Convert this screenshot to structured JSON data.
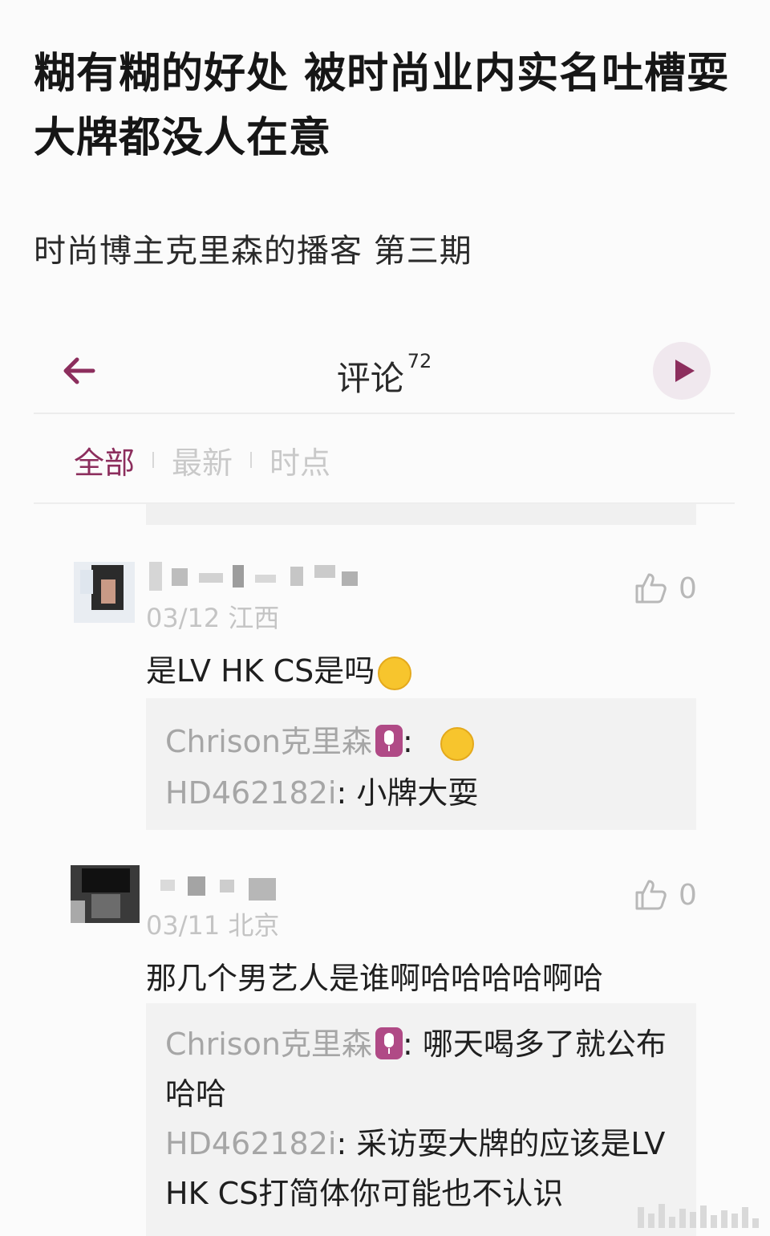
{
  "article": {
    "headline": "糊有糊的好处 被时尚业内实名吐槽耍大牌都没人在意",
    "subtitle": "时尚博主克里森的播客 第三期"
  },
  "nav": {
    "title": "评论",
    "count": "72",
    "back_icon": "back-arrow-icon",
    "play_icon": "play-icon"
  },
  "filters": {
    "tabs": [
      "全部",
      "最新",
      "时点"
    ],
    "active_index": 0
  },
  "colors": {
    "accent": "#8c2e5d",
    "badge": "#b04a86",
    "muted": "#c4c4c4"
  },
  "comments": [
    {
      "meta": "03/12 江西",
      "likes": "0",
      "text": "是LV HK CS是吗",
      "emoji": "smirking-face-emoji",
      "replies": [
        {
          "name": "Chrison克里森",
          "verified_badge": "mic-icon",
          "sep": ":",
          "text": "",
          "emoji": "shushing-face-emoji"
        },
        {
          "name": "HD462182i",
          "sep": ":",
          "text": "小牌大耍"
        }
      ]
    },
    {
      "meta": "03/11 北京",
      "likes": "0",
      "text": "那几个男艺人是谁啊哈哈哈哈啊哈",
      "replies": [
        {
          "name": "Chrison克里森",
          "verified_badge": "mic-icon",
          "sep": ":",
          "text": "哪天喝多了就公布哈哈"
        },
        {
          "name": "HD462182i",
          "sep": ":",
          "text": "采访耍大牌的应该是LV HK CS打简体你可能也不认识"
        }
      ]
    }
  ]
}
